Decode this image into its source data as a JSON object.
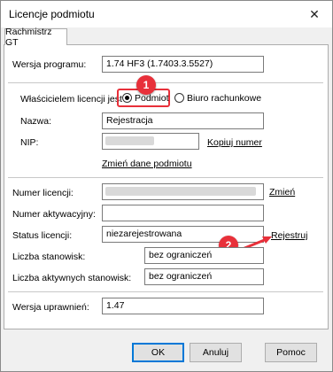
{
  "window": {
    "title": "Licencje podmiotu",
    "close_glyph": "✕"
  },
  "tabs": [
    {
      "label": "Rachmistrz GT"
    }
  ],
  "form": {
    "wersja_programu": {
      "label": "Wersja programu:",
      "value": "1.74 HF3 (1.7403.3.5527)"
    },
    "wlasciciel": {
      "label": "Właścicielem licencji jest",
      "options": [
        "Podmiot",
        "Biuro rachunkowe"
      ],
      "selected": "Podmiot"
    },
    "nazwa": {
      "label": "Nazwa:",
      "value": "Rejestracja"
    },
    "nip": {
      "label": "NIP:",
      "value": ""
    },
    "links": {
      "kopiuj_numer": "Kopiuj numer",
      "zmien_dane": "Zmień dane podmiotu",
      "zmien": "Zmień",
      "rejestruj": "Rejestruj"
    },
    "numer_licencji": {
      "label": "Numer licencji:",
      "value": ""
    },
    "numer_aktywacyjny": {
      "label": "Numer aktywacyjny:",
      "value": ""
    },
    "status_licencji": {
      "label": "Status licencji:",
      "value": "niezarejestrowana"
    },
    "liczba_stanowisk": {
      "label": "Liczba stanowisk:",
      "value": "bez ograniczeń"
    },
    "liczba_aktywnych": {
      "label": "Liczba aktywnych stanowisk:",
      "value": "bez ograniczeń"
    },
    "wersja_uprawnien": {
      "label": "Wersja uprawnień:",
      "value": "1.47"
    }
  },
  "annotations": {
    "marker1": "1",
    "marker2": "2",
    "color": "#e8303a"
  },
  "buttons": {
    "ok": "OK",
    "cancel": "Anuluj",
    "help": "Pomoc"
  }
}
